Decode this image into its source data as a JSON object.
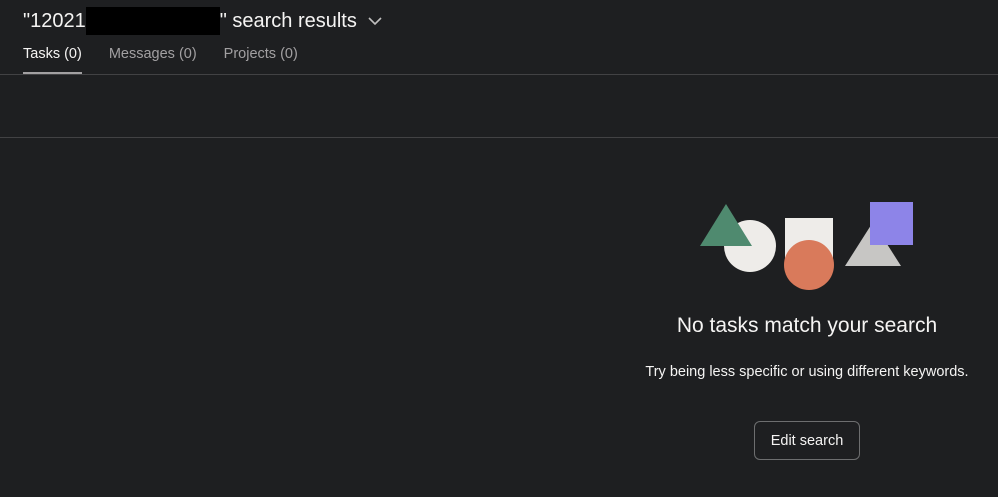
{
  "header": {
    "title_prefix": "\"12021",
    "title_suffix": "\" search results",
    "dropdown_icon": "chevron-down-icon",
    "tabs": [
      {
        "label": "Tasks (0)",
        "active": true
      },
      {
        "label": "Messages (0)",
        "active": false
      },
      {
        "label": "Projects (0)",
        "active": false
      }
    ]
  },
  "empty_state": {
    "title": "No tasks match your search",
    "subtitle": "Try being less specific or using different keywords.",
    "button_label": "Edit search",
    "illustration_colors": {
      "triangle_green": "#4f8a6f",
      "circle_white": "#eeece9",
      "square_white": "#eeece9",
      "circle_orange": "#d97a5b",
      "triangle_gray": "#c7c6c4",
      "square_purple": "#8d84e8"
    }
  },
  "colors": {
    "background": "#1e1f21",
    "divider": "#424244",
    "text_primary": "#f5f4f3",
    "text_secondary": "#a2a0a2"
  }
}
